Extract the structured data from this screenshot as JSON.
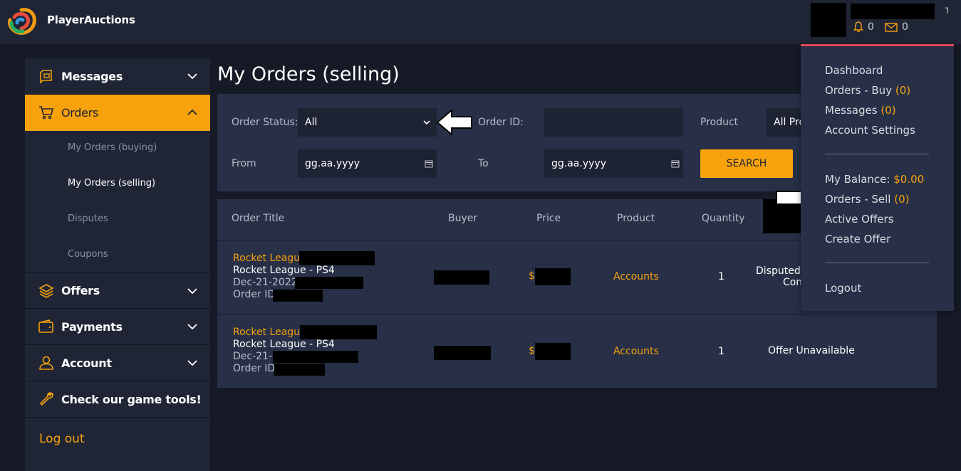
{
  "brand": {
    "name": "PlayerAuctions"
  },
  "header": {
    "bell_count": "0",
    "mail_count": "0"
  },
  "sidebar": {
    "messages": "Messages",
    "orders": "Orders",
    "orders_sub": [
      "My Orders (buying)",
      "My Orders (selling)",
      "Disputes",
      "Coupons"
    ],
    "offers": "Offers",
    "payments": "Payments",
    "account": "Account",
    "tools": "Check our game tools!",
    "logout": "Log out"
  },
  "page": {
    "title": "My Orders (selling)"
  },
  "filters": {
    "status_label": "Order Status:",
    "status_value": "All",
    "order_id_label": "Order ID:",
    "product_label": "Product",
    "product_value": "All Pro",
    "from_label": "From",
    "from_value": "gg.aa.yyyy",
    "to_label": "To",
    "to_value": "gg.aa.yyyy",
    "search_button": "SEARCH"
  },
  "table": {
    "headers": [
      "Order Title",
      "Buyer",
      "Price",
      "Product",
      "Quantity"
    ],
    "rows": [
      {
        "title": "Rocket League",
        "subtitle": "Rocket League - PS4",
        "date": "Dec-21-2022",
        "order_id_label": "Order ID:",
        "price_prefix": "$",
        "product": "Accounts",
        "quantity": "1",
        "status_line1": "Disputed",
        "status_line2": "Com"
      },
      {
        "title": "Rocket League",
        "subtitle": "Rocket League - PS4",
        "date": "Dec-21-",
        "order_id_label": "Order ID:",
        "price_prefix": "$",
        "product": "Accounts",
        "quantity": "1",
        "status_line1": "Offer Unavailable"
      }
    ]
  },
  "user_menu": {
    "dashboard": "Dashboard",
    "orders_buy": "Orders - Buy",
    "orders_buy_count": "(0)",
    "messages": "Messages",
    "messages_count": "(0)",
    "account_settings": "Account Settings",
    "balance_label": "My Balance:",
    "balance_value": "$0.00",
    "orders_sell": "Orders - Sell",
    "orders_sell_count": "(0)",
    "active_offers": "Active Offers",
    "create_offer": "Create Offer",
    "logout": "Logout"
  },
  "colors": {
    "accent": "#f7a20c",
    "panel": "#273046",
    "sidebar": "#1f2535",
    "background": "#151a26"
  }
}
